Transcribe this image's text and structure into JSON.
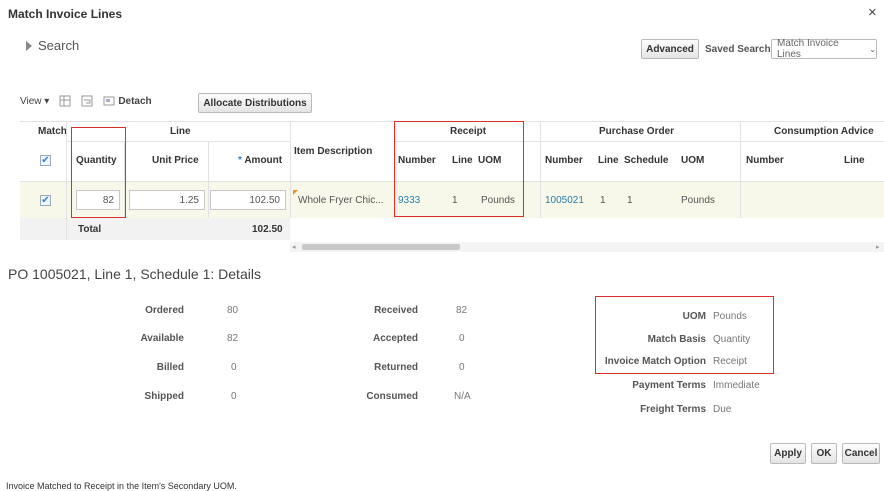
{
  "dialog": {
    "title": "Match Invoice Lines",
    "close_glyph": "×"
  },
  "search": {
    "label": "Search",
    "advanced_label": "Advanced",
    "saved_search_label": "Saved Search",
    "saved_search_value": "Match Invoice Lines"
  },
  "toolbar": {
    "view_label": "View",
    "detach_label": "Detach",
    "allocate_label": "Allocate Distributions"
  },
  "table": {
    "group_headers": {
      "match": "Match",
      "line": "Line",
      "receipt": "Receipt",
      "purchase_order": "Purchase Order",
      "consumption_advice": "Consumption Advice"
    },
    "columns": {
      "quantity": "Quantity",
      "unit_price": "Unit Price",
      "amount": "Amount",
      "amount_required": "*",
      "item_description": "Item Description",
      "receipt_number": "Number",
      "receipt_line": "Line",
      "receipt_uom": "UOM",
      "po_number": "Number",
      "po_line": "Line",
      "po_schedule": "Schedule",
      "po_uom": "UOM",
      "ca_number": "Number",
      "ca_line": "Line"
    },
    "row": {
      "matched": true,
      "quantity": "82",
      "unit_price": "1.25",
      "amount": "102.50",
      "item_description": "Whole Fryer Chic...",
      "receipt_number": "9333",
      "receipt_line": "1",
      "receipt_uom": "Pounds",
      "po_number": "1005021",
      "po_line": "1",
      "po_schedule": "1",
      "po_uom": "Pounds"
    },
    "total_label": "Total",
    "total_amount": "102.50"
  },
  "details": {
    "title": "PO 1005021, Line 1, Schedule 1: Details",
    "col1": [
      {
        "label": "Ordered",
        "value": "80"
      },
      {
        "label": "Available",
        "value": "82"
      },
      {
        "label": "Billed",
        "value": "0"
      },
      {
        "label": "Shipped",
        "value": "0"
      }
    ],
    "col2": [
      {
        "label": "Received",
        "value": "82"
      },
      {
        "label": "Accepted",
        "value": "0"
      },
      {
        "label": "Returned",
        "value": "0"
      },
      {
        "label": "Consumed",
        "value": "N/A"
      }
    ],
    "col3": [
      {
        "label": "UOM",
        "value": "Pounds"
      },
      {
        "label": "Match Basis",
        "value": "Quantity"
      },
      {
        "label": "Invoice Match Option",
        "value": "Receipt"
      },
      {
        "label": "Payment Terms",
        "value": "Immediate"
      },
      {
        "label": "Freight Terms",
        "value": "Due"
      }
    ]
  },
  "footer": {
    "apply_label": "Apply",
    "ok_label": "OK",
    "cancel_label": "Cancel"
  },
  "status_text": "Invoice Matched to Receipt in the Item's Secondary UOM.",
  "colors": {
    "highlight_row": "#f7f8e9",
    "annotation_red": "#d9302b",
    "link_blue": "#2a7fa8"
  }
}
